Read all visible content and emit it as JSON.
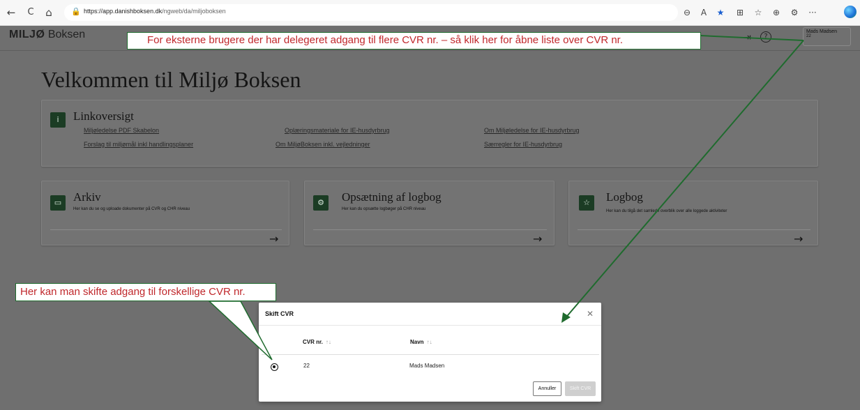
{
  "browser": {
    "back_glyph": "←",
    "reload_glyph": "C",
    "home_glyph": "⌂",
    "lock_glyph": "🔒",
    "url_host": "https://app.danishboksen.dk",
    "url_path": "/ngweb/da/miljoboksen",
    "tool_glyphs": {
      "zoom": "⊖",
      "read_aloud": "A",
      "favorite": "★",
      "split": "⊞",
      "favorites_bar": "☆",
      "collections": "⊕",
      "extensions": "⚙",
      "more": "···"
    }
  },
  "header": {
    "brand_bold": "MILJØ",
    "brand_light": " Boksen",
    "logout_glyph": "⇥",
    "help_glyph": "?",
    "user_name": "Mads Madsen",
    "user_cvr": "22"
  },
  "page": {
    "title": "Velkommen til Miljø Boksen"
  },
  "link_card": {
    "icon_glyph": "i",
    "title": "Linkoversigt",
    "links": [
      "Miljøledelse PDF Skabelon",
      "Forslag til miljømål inkl handlingsplaner",
      "Oplæringsmateriale for IE-husdyrbrug",
      "Om MiljøBoksen inkl. vejledninger",
      "Om Miljøledelse for IE-husdyrbrug",
      "Særregler for IE-husdyrbrug"
    ]
  },
  "cards": [
    {
      "icon_glyph": "▭",
      "title": "Arkiv",
      "desc": "Her kan du se og uploade dokumenter på CVR og CHR niveau",
      "arrow": "→"
    },
    {
      "icon_glyph": "⚙",
      "title": "Opsætning af logbog",
      "desc": "Her kan du opsætte logbøger på CHR niveau",
      "arrow": "→"
    },
    {
      "icon_glyph": "☆",
      "title": "Logbog",
      "desc": "Her kan du tilgå det samlede overblik over alle loggede aktiviteter",
      "arrow": "→"
    }
  ],
  "modal": {
    "title": "Skift CVR",
    "close_glyph": "✕",
    "col_cvr": "CVR nr.",
    "col_name": "Navn",
    "sort_glyph": "↑↓",
    "rows": [
      {
        "cvr": "22",
        "name": "Mads Madsen",
        "selected": true
      }
    ],
    "cancel_label": "Annuller",
    "switch_label": "Skift CVR"
  },
  "annotations": {
    "top_note": "For eksterne brugere der har delegeret adgang til flere CVR nr. – så klik her for åbne liste over CVR nr.",
    "left_note": "Her kan man skifte adgang til forskellige CVR nr."
  },
  "colors": {
    "overlay": "#6f6f6f",
    "brand_green": "#1b3c24",
    "annotation_red": "#c0282c",
    "annotation_border": "#1f6b2e"
  }
}
